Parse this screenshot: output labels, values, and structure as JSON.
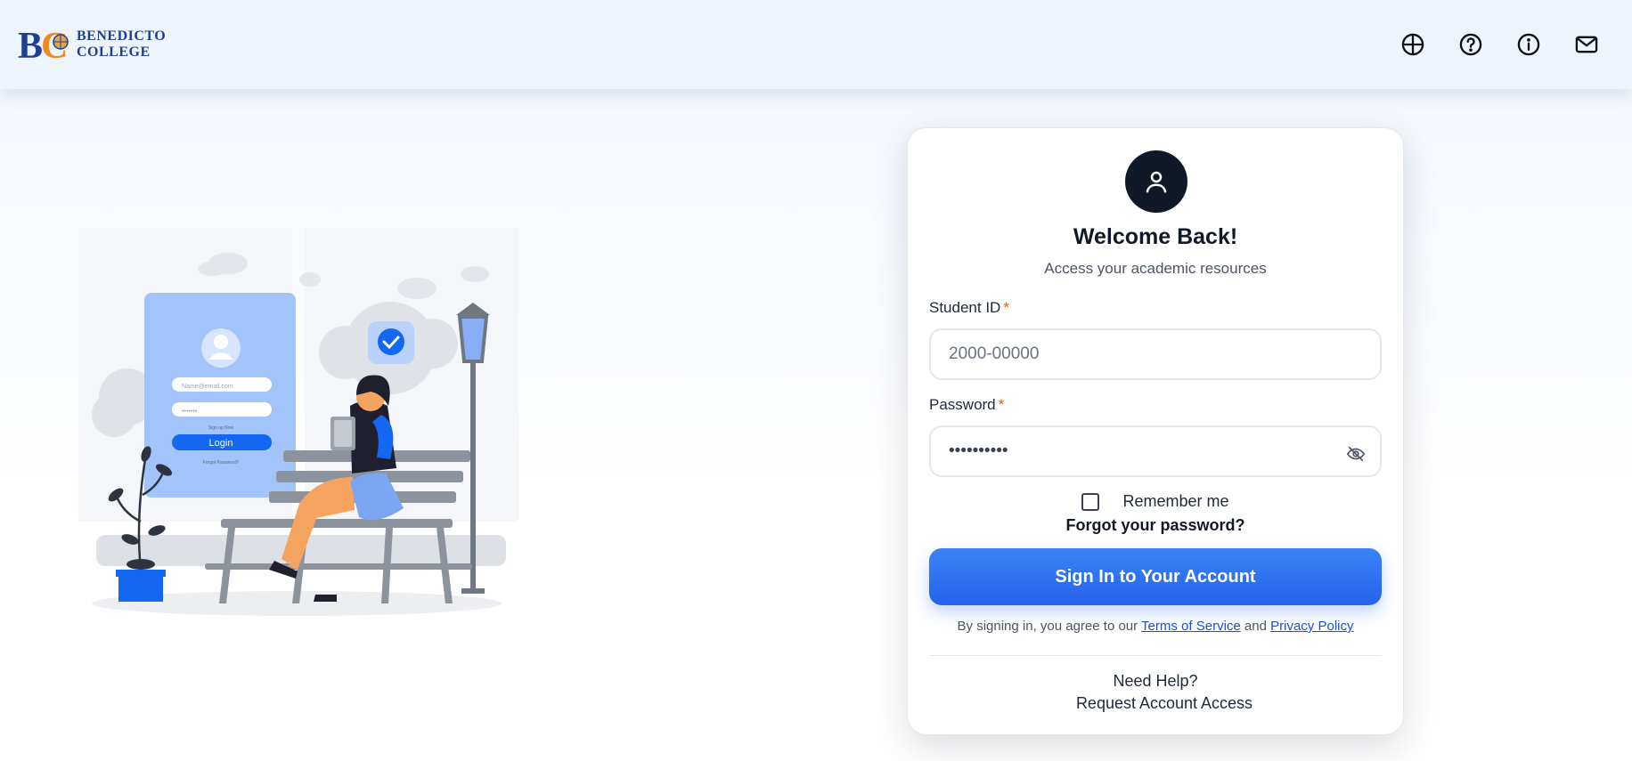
{
  "logo": {
    "line1": "BENEDICTO",
    "line2": "COLLEGE",
    "icon": "bc-college-logo"
  },
  "nav": {
    "icons": [
      "globe-icon",
      "help-circle-icon",
      "info-icon",
      "mail-icon",
      "user-icon"
    ]
  },
  "illustration": {
    "icon": "login-illustration",
    "email_placeholder": "Name@email.com",
    "login_label": "Login",
    "sign_up_label": "Sign up Now",
    "forgot_label": "Forgot Password?"
  },
  "card": {
    "title": "Welcome Back!",
    "subtitle": "Access your academic resources",
    "student_id": {
      "label": "Student ID",
      "required_mark": "*",
      "placeholder": "2000-00000",
      "value": ""
    },
    "password": {
      "label": "Password",
      "required_mark": "*",
      "value": "••••••••••"
    },
    "remember_label": "Remember me",
    "remember_checked": false,
    "forgot_label": "Forgot your password?",
    "signin_label": "Sign In to Your Account",
    "terms_prefix": "By signing in, you agree to our",
    "terms_link": "Terms of Service",
    "terms_and": "and",
    "privacy_link": "Privacy Policy",
    "help_label": "Need Help?",
    "request_label": "Request Account Access"
  },
  "colors": {
    "primary": "#2563eb",
    "topbar_bg": "#eef4fc",
    "avatar_bg": "#111827",
    "required": "#ea580c"
  }
}
